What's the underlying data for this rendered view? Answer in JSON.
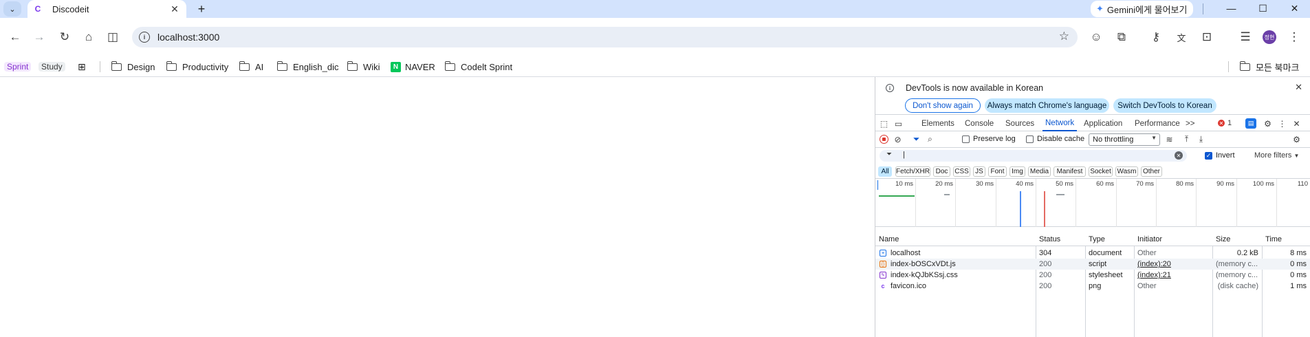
{
  "browser": {
    "tab_title": "Discodeit",
    "tab_favicon": "C",
    "gemini_button": "Gemini에게 물어보기",
    "url": "localhost:3000",
    "profile_initials": "정현"
  },
  "bookmarks": {
    "tags": [
      "Sprint",
      "Study"
    ],
    "folders": [
      "Design",
      "Productivity",
      "AI",
      "English_dic",
      "Wiki"
    ],
    "naver": "NAVER",
    "codeit_sprint": "Codelt Sprint",
    "all_bookmarks": "모든 북마크"
  },
  "devtools": {
    "banner": {
      "message": "DevTools is now available in Korean",
      "dont_show": "Don't show again",
      "always_match": "Always match Chrome's language",
      "switch_korean": "Switch DevTools to Korean"
    },
    "tabs": [
      "Elements",
      "Console",
      "Sources",
      "Network",
      "Application",
      "Performance"
    ],
    "more_tabs": ">>",
    "error_count": "1",
    "network": {
      "preserve_log": "Preserve log",
      "disable_cache": "Disable cache",
      "throttling": "No throttling",
      "filter_value": "|",
      "invert": "Invert",
      "more_filters": "More filters",
      "type_filters": [
        "All",
        "Fetch/XHR",
        "Doc",
        "CSS",
        "JS",
        "Font",
        "Img",
        "Media",
        "Manifest",
        "Socket",
        "Wasm",
        "Other"
      ],
      "timeline_labels": [
        "10 ms",
        "20 ms",
        "30 ms",
        "40 ms",
        "50 ms",
        "60 ms",
        "70 ms",
        "80 ms",
        "90 ms",
        "100 ms",
        "110"
      ],
      "columns": [
        "Name",
        "Status",
        "Type",
        "Initiator",
        "Size",
        "Time"
      ],
      "rows": [
        {
          "name": "localhost",
          "status": "304",
          "type": "document",
          "initiator": "Other",
          "size": "0.2 kB",
          "time": "8 ms"
        },
        {
          "name": "index-bOSCxVDt.js",
          "status": "200",
          "type": "script",
          "initiator": "(index):20",
          "size": "(memory c...",
          "time": "0 ms"
        },
        {
          "name": "index-kQJbKSsj.css",
          "status": "200",
          "type": "stylesheet",
          "initiator": "(index):21",
          "size": "(memory c...",
          "time": "0 ms"
        },
        {
          "name": "favicon.ico",
          "status": "200",
          "type": "png",
          "initiator": "Other",
          "size": "(disk cache)",
          "time": "1 ms"
        }
      ]
    }
  },
  "colors": {
    "tabstrip": "#d3e3fd",
    "accent": "#0b57d0",
    "error": "#dc362e"
  }
}
